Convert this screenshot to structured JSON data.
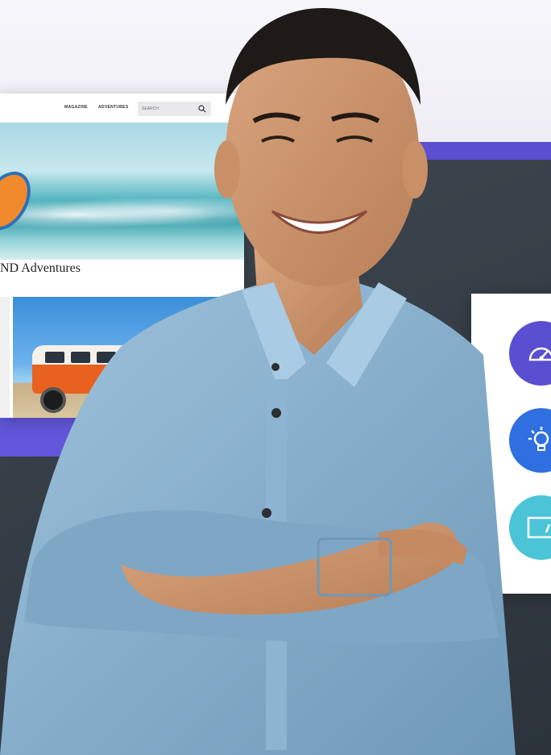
{
  "site": {
    "nav": [
      "MAGAZINE",
      "ADVENTURES"
    ],
    "search_placeholder": "SEARCH",
    "title": "ND Adventures"
  },
  "panel": {
    "features": [
      {
        "icon": "speedometer-icon",
        "color": "#5a4fd0"
      },
      {
        "icon": "lightbulb-icon",
        "color": "#2f6fe0"
      },
      {
        "icon": "monitor-icon",
        "color": "#4cc4d8"
      }
    ]
  },
  "colors": {
    "accent_purple": "#5a4fd0",
    "background_dark": "#353d46"
  }
}
